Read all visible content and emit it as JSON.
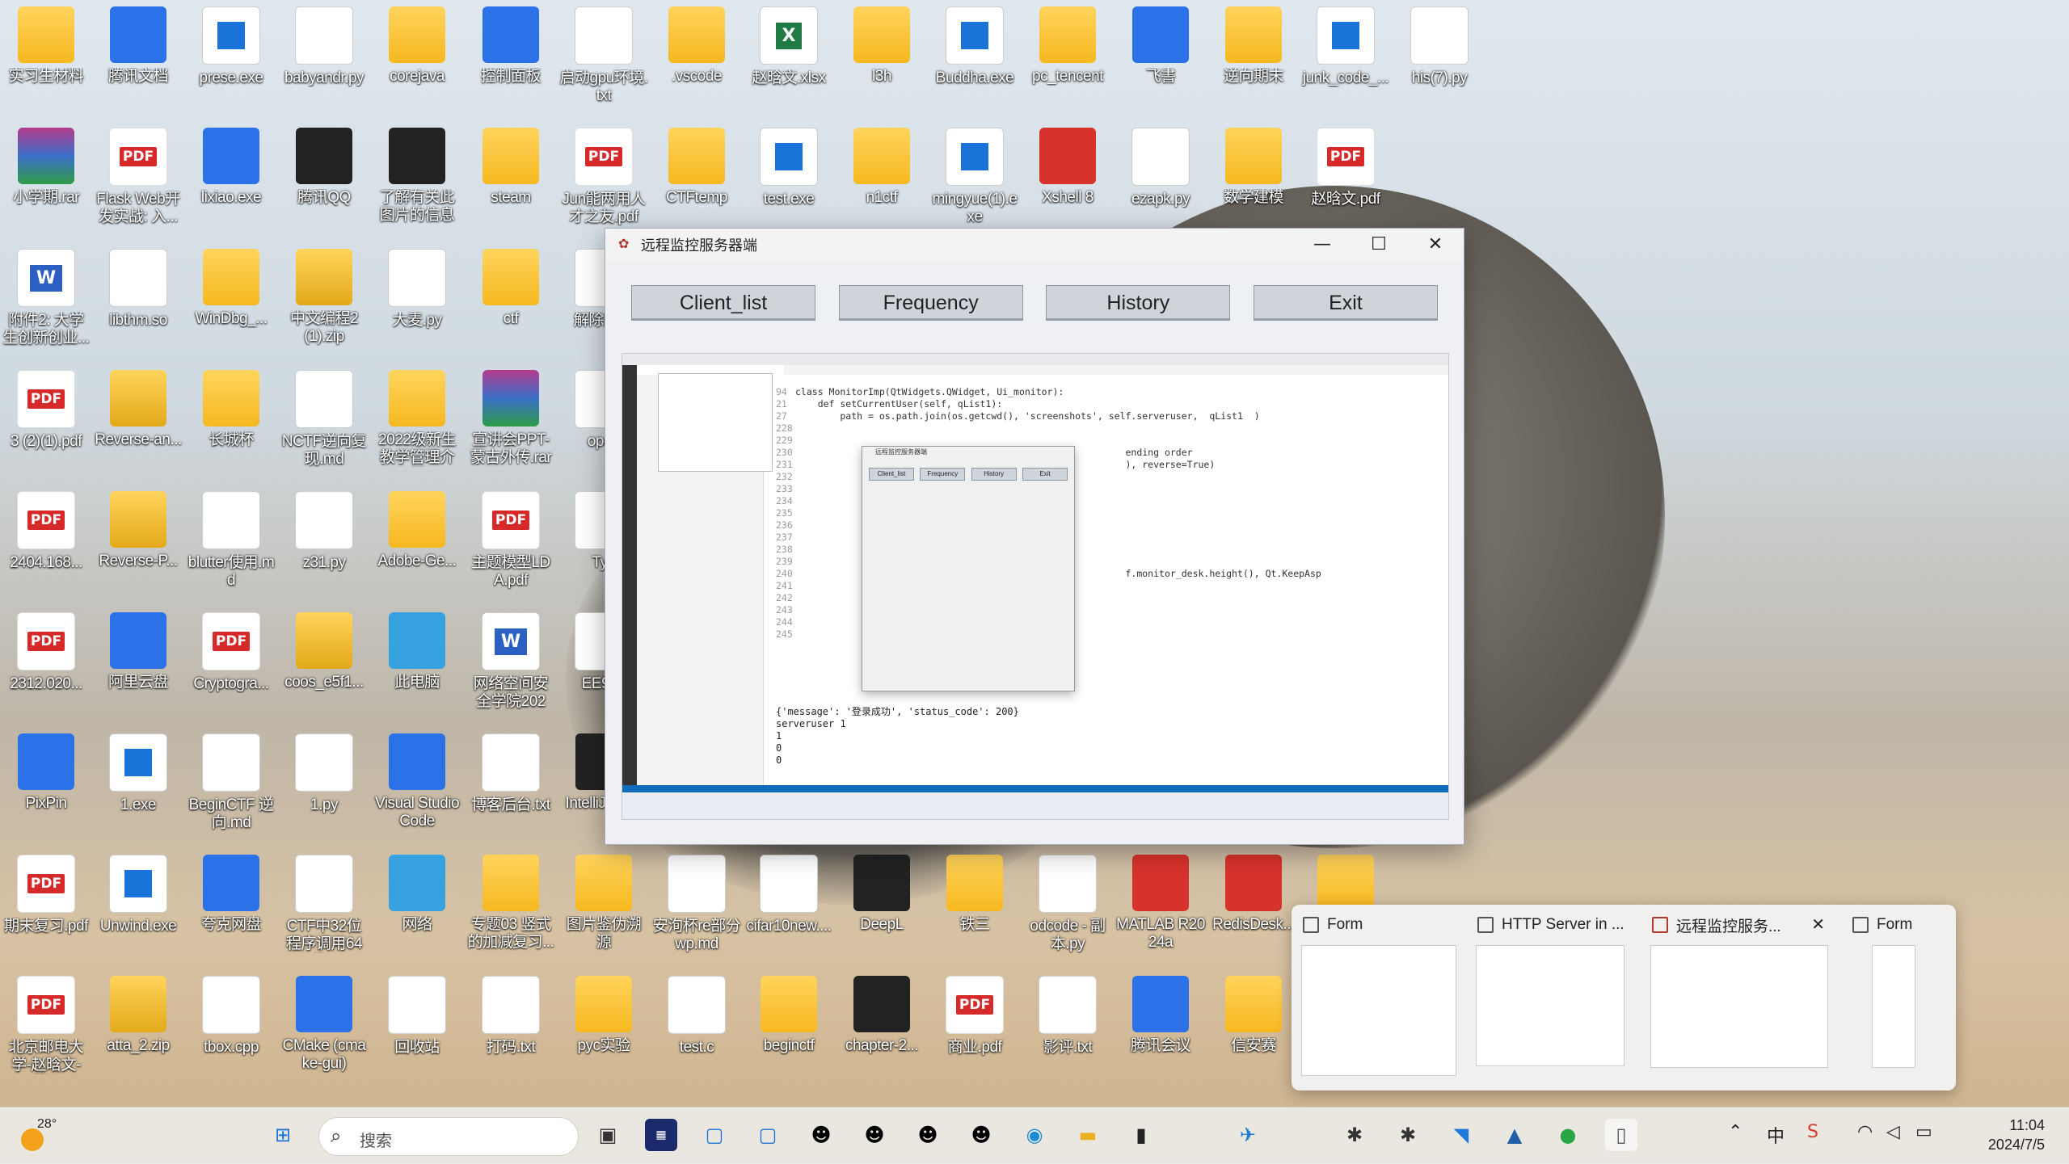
{
  "desktop": {
    "icons": [
      {
        "label": "实习生材料",
        "type": "folder"
      },
      {
        "label": "腾讯文档",
        "type": "app"
      },
      {
        "label": "prese.exe",
        "type": "exe"
      },
      {
        "label": "babyandr.py",
        "type": "py"
      },
      {
        "label": "corejava",
        "type": "folder"
      },
      {
        "label": "控制面板",
        "type": "app"
      },
      {
        "label": "启动gpu环境.txt",
        "type": "txt"
      },
      {
        "label": ".vscode",
        "type": "folder"
      },
      {
        "label": "赵晗文.xlsx",
        "type": "xls"
      },
      {
        "label": "l3h",
        "type": "folder"
      },
      {
        "label": "Buddha.exe",
        "type": "exe"
      },
      {
        "label": "pc_tencent",
        "type": "folder"
      },
      {
        "label": "飞書",
        "type": "app"
      },
      {
        "label": "逆向期末",
        "type": "folder"
      },
      {
        "label": "junk_code_...",
        "type": "exe"
      },
      {
        "label": "his(7).py",
        "type": "py"
      },
      {
        "label": "小学期.rar",
        "type": "rar"
      },
      {
        "label": "Flask Web开发实战: 入...",
        "type": "pdf"
      },
      {
        "label": "lixiao.exe",
        "type": "app"
      },
      {
        "label": "腾讯QQ",
        "type": "dark"
      },
      {
        "label": "了解有关此图片的信息",
        "type": "dark"
      },
      {
        "label": "steam",
        "type": "folder"
      },
      {
        "label": "Jun能两用人才之友.pdf",
        "type": "pdf"
      },
      {
        "label": "CTFtemp",
        "type": "folder"
      },
      {
        "label": "test.exe",
        "type": "exe"
      },
      {
        "label": "n1ctf",
        "type": "folder"
      },
      {
        "label": "mingyue(1).exe",
        "type": "exe"
      },
      {
        "label": "Xshell 8",
        "type": "red"
      },
      {
        "label": "ezapk.py",
        "type": "py"
      },
      {
        "label": "数学建模",
        "type": "folder"
      },
      {
        "label": "赵晗文.pdf",
        "type": "pdf"
      },
      {
        "label": "附件2: 大学生创新创业...",
        "type": "word"
      },
      {
        "label": "libthm.so",
        "type": "txt"
      },
      {
        "label": "WinDbg_...",
        "type": "folder"
      },
      {
        "label": "中文编程2(1).zip",
        "type": "zip"
      },
      {
        "label": "大麦.py",
        "type": "py"
      },
      {
        "label": "ctf",
        "type": "folder"
      },
      {
        "label": "解除限制",
        "type": "txt"
      },
      {
        "label": "3 (2)(1).pdf",
        "type": "pdf"
      },
      {
        "label": "Reverse-an...",
        "type": "zip"
      },
      {
        "label": "长城杯",
        "type": "folder"
      },
      {
        "label": "NCTF逆向复现.md",
        "type": "txt"
      },
      {
        "label": "2022级新生教学管理介绍",
        "type": "folder"
      },
      {
        "label": "宣讲会PPT-蒙古外传.rar",
        "type": "rar"
      },
      {
        "label": "open",
        "type": "txt"
      },
      {
        "label": "2404.168...",
        "type": "pdf"
      },
      {
        "label": "Reverse-P...",
        "type": "zip"
      },
      {
        "label": "blutter使用.md",
        "type": "txt"
      },
      {
        "label": "z31.py",
        "type": "py"
      },
      {
        "label": "Adobe-Ge...",
        "type": "folder"
      },
      {
        "label": "主题模型LDA.pdf",
        "type": "pdf"
      },
      {
        "label": "Typ",
        "type": "txt"
      },
      {
        "label": "2312.020...",
        "type": "pdf"
      },
      {
        "label": "阿里云盘",
        "type": "app"
      },
      {
        "label": "Cryptogra...",
        "type": "pdf"
      },
      {
        "label": "coos_e5f1...",
        "type": "zip"
      },
      {
        "label": "此电脑",
        "type": "cyan"
      },
      {
        "label": "网络空间安全学院2022...",
        "type": "word"
      },
      {
        "label": "EE902",
        "type": "txt"
      },
      {
        "label": "PixPin",
        "type": "app"
      },
      {
        "label": "1.exe",
        "type": "exe"
      },
      {
        "label": "BeginCTF 逆向.md",
        "type": "txt"
      },
      {
        "label": "1.py",
        "type": "py"
      },
      {
        "label": "Visual Studio Code",
        "type": "app"
      },
      {
        "label": "博客后台.txt",
        "type": "txt"
      },
      {
        "label": "IntelliJ 2023",
        "type": "dark"
      },
      {
        "label": "期末复习.pdf",
        "type": "pdf"
      },
      {
        "label": "Unwind.exe",
        "type": "exe"
      },
      {
        "label": "夸克网盘",
        "type": "app"
      },
      {
        "label": "CTF中32位程序调用64位...",
        "type": "txt"
      },
      {
        "label": "网络",
        "type": "cyan"
      },
      {
        "label": "专题03 竖式的加减复习...",
        "type": "folder"
      },
      {
        "label": "图片鉴伪溯源",
        "type": "folder"
      },
      {
        "label": "安洵杯re部分wp.md",
        "type": "txt"
      },
      {
        "label": "cifar10new....",
        "type": "py"
      },
      {
        "label": "DeepL",
        "type": "dark"
      },
      {
        "label": "铁三",
        "type": "folder"
      },
      {
        "label": "odcode - 副本.py",
        "type": "py"
      },
      {
        "label": "MATLAB R2024a",
        "type": "red"
      },
      {
        "label": "RedisDesk...",
        "type": "red"
      },
      {
        "label": "",
        "type": "folder"
      },
      {
        "label": "北京邮电大学-赵晗文-简...",
        "type": "pdf"
      },
      {
        "label": "atta_2.zip",
        "type": "zip"
      },
      {
        "label": "tbox.cpp",
        "type": "txt"
      },
      {
        "label": "CMake (cmake-gui)",
        "type": "app"
      },
      {
        "label": "回收站",
        "type": "txt"
      },
      {
        "label": "打码.txt",
        "type": "txt"
      },
      {
        "label": "pyc实验",
        "type": "folder"
      },
      {
        "label": "test.c",
        "type": "txt"
      },
      {
        "label": "beginctf",
        "type": "folder"
      },
      {
        "label": "chapter-2...",
        "type": "dark"
      },
      {
        "label": "商业.pdf",
        "type": "pdf"
      },
      {
        "label": "影评.txt",
        "type": "txt"
      },
      {
        "label": "腾讯会议",
        "type": "app"
      },
      {
        "label": "信安赛",
        "type": "folder"
      }
    ]
  },
  "window": {
    "title": "远程监控服务器端",
    "minimize": "—",
    "maximize": "☐",
    "close": "✕",
    "buttons": [
      "Client_list",
      "Frequency",
      "History",
      "Exit"
    ]
  },
  "screen": {
    "code_lines": [
      {
        "n": "94",
        "code": "class MonitorImp(QtWidgets.QWidget, Ui_monitor):"
      },
      {
        "n": "21",
        "code": "    def setCurrentUser(self, qList1):"
      },
      {
        "n": "27",
        "code": "        path = os.path.join(os.getcwd(), 'screenshots', self.serveruser,  qList1  )"
      },
      {
        "n": "228",
        "code": ""
      },
      {
        "n": "229",
        "code": ""
      },
      {
        "n": "230",
        "code": "                                                           ending order"
      },
      {
        "n": "231",
        "code": "                                                           ), reverse=True)"
      },
      {
        "n": "232",
        "code": ""
      },
      {
        "n": "233",
        "code": ""
      },
      {
        "n": "234",
        "code": ""
      },
      {
        "n": "235",
        "code": ""
      },
      {
        "n": "236",
        "code": ""
      },
      {
        "n": "237",
        "code": ""
      },
      {
        "n": "238",
        "code": ""
      },
      {
        "n": "239",
        "code": ""
      },
      {
        "n": "240",
        "code": "                                                           f.monitor_desk.height(), Qt.KeepAsp"
      },
      {
        "n": "241",
        "code": ""
      },
      {
        "n": "242",
        "code": ""
      },
      {
        "n": "243",
        "code": ""
      },
      {
        "n": "244",
        "code": ""
      },
      {
        "n": "245",
        "code": ""
      }
    ],
    "terminal": [
      "{'message': '登录成功', 'status_code': 200}",
      "serveruser 1",
      "1",
      "0",
      "0"
    ],
    "inner_title": "远程监控服务器端",
    "inner_buttons": [
      "Client_list",
      "Frequency",
      "History",
      "Exit"
    ]
  },
  "popup": {
    "cards": [
      {
        "title": "Form"
      },
      {
        "title": "HTTP Server in ..."
      },
      {
        "title": "远程监控服务..."
      },
      {
        "title": "Form"
      }
    ],
    "close": "✕"
  },
  "taskbar": {
    "weather_temp": "28°",
    "search_placeholder": "搜索",
    "time": "11:04",
    "date": "2024/7/5"
  }
}
